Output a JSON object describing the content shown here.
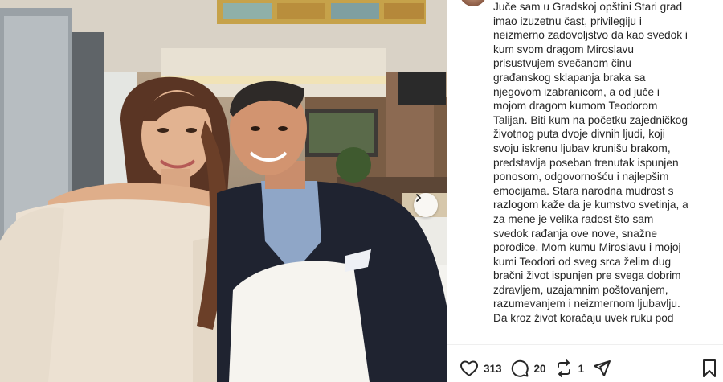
{
  "caption": {
    "lines": [
      "Juče sam u Gradskoj opštini Stari grad",
      "imao izuzetnu čast, privilegiju i",
      "neizmerno zadovoljstvo da kao svedok i",
      "kum svom dragom Miroslavu",
      "prisustvujem svečanom činu",
      "građanskog sklapanja braka sa",
      "njegovom izabranicom, a od juče i",
      "mojom dragom kumom Teodorom",
      "Talijan. Biti kum na početku zajedničkog",
      "životnog puta dvoje divnih ljudi, koji",
      "svoju iskrenu ljubav krunišu brakom,",
      "predstavlja poseban trenutak ispunjen",
      "ponosom, odgovornošću i najlepšim",
      "emocijama. Stara narodna mudrost s",
      "razlogom kaže da je kumstvo svetinja, a",
      "za mene je velika radost što sam",
      "svedok rađanja ove nove, snažne",
      "porodice. Mom kumu Miroslavu i mojoj",
      "kumi Teodori od sveg srca želim dug",
      "bračni život ispunjen pre svega dobrim",
      "zdravljem, uzajamnim poštovanjem,",
      "razumevanjem i neizmernom ljubavlju.",
      "Da kroz život koračaju uvek ruku pod"
    ]
  },
  "actions": {
    "likes": "313",
    "comments": "20",
    "reposts": "1"
  },
  "icons": {
    "like": "heart-icon",
    "comment": "comment-bubble-icon",
    "repost": "repost-icon",
    "share": "send-icon",
    "save": "bookmark-icon",
    "next": "chevron-right-icon"
  }
}
